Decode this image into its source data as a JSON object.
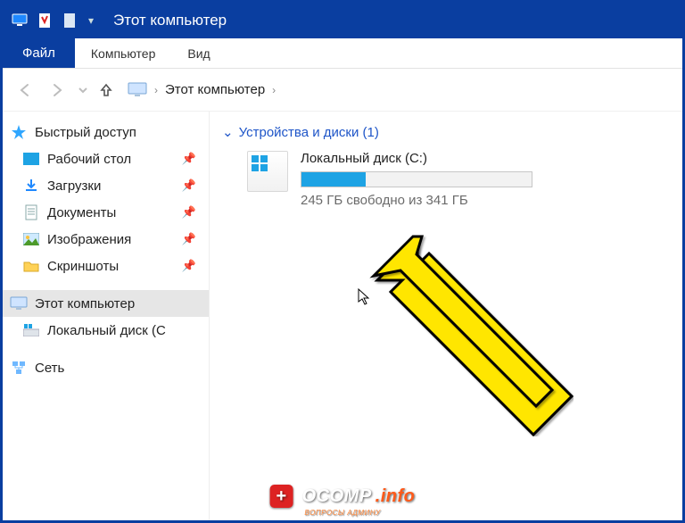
{
  "titlebar": {
    "title": "Этот компьютер"
  },
  "menu": {
    "file": "Файл",
    "computer": "Компьютер",
    "view": "Вид"
  },
  "breadcrumb": {
    "label": "Этот компьютер"
  },
  "sidebar": {
    "quick_access": "Быстрый доступ",
    "items": {
      "desktop": "Рабочий стол",
      "downloads": "Загрузки",
      "documents": "Документы",
      "pictures": "Изображения",
      "screenshots": "Скриншоты"
    },
    "this_pc": "Этот компьютер",
    "local_disk": "Локальный диск (C",
    "network": "Сеть"
  },
  "content": {
    "group_header": "Устройства и диски (1)",
    "drive": {
      "name": "Локальный диск (C:)",
      "sub": "245 ГБ свободно из 341 ГБ",
      "used_percent": 28
    }
  },
  "watermark": {
    "brand_main": "OCOMP",
    "brand_suffix": ".info",
    "sub": "ВОПРОСЫ АДМИНУ"
  }
}
